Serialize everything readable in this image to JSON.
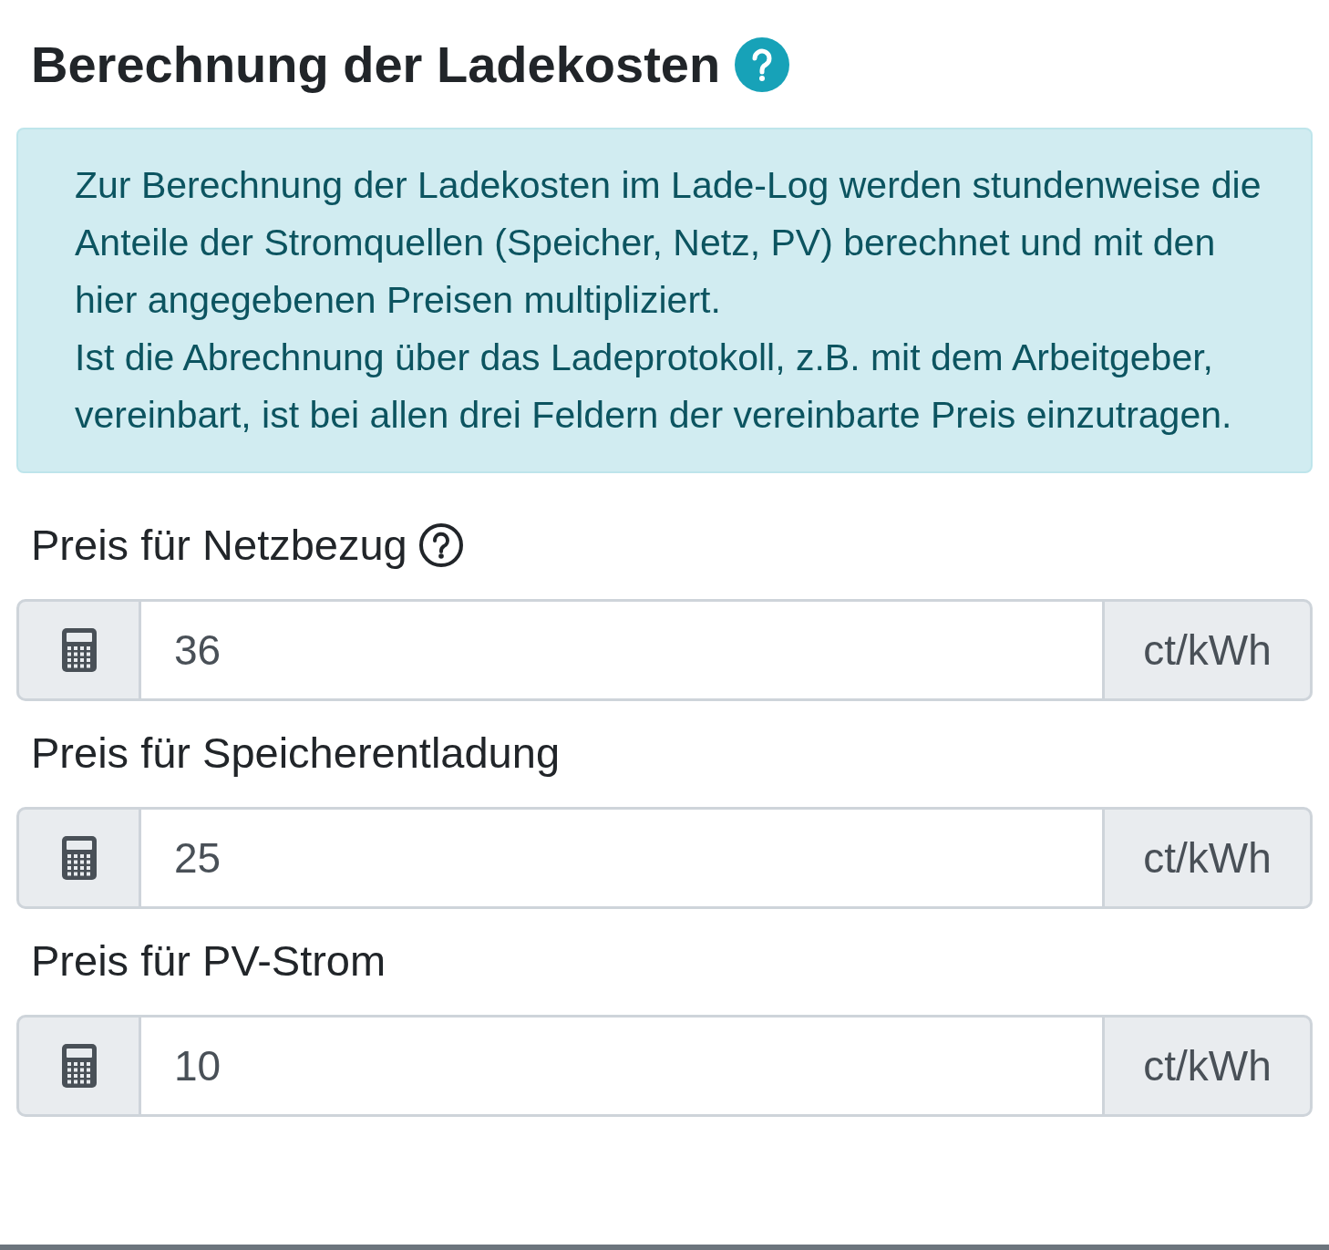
{
  "title": "Berechnung der Ladekosten",
  "info": [
    "Zur Berechnung der Ladekosten im Lade-Log werden stundenweise die Anteile der Stromquellen (Speicher, Netz, PV) berechnet und mit den hier angegebenen Preisen multipliziert.",
    "Ist die Abrechnung über das Ladeprotokoll, z.B. mit dem Arbeitgeber, vereinbart, ist bei allen drei Feldern der vereinbarte Preis einzutragen."
  ],
  "fields": [
    {
      "label": "Preis für Netzbezug",
      "help": true,
      "value": "36",
      "unit": "ct/kWh"
    },
    {
      "label": "Preis für Speicherentladung",
      "help": false,
      "value": "25",
      "unit": "ct/kWh"
    },
    {
      "label": "Preis für PV-Strom",
      "help": false,
      "value": "10",
      "unit": "ct/kWh"
    }
  ]
}
